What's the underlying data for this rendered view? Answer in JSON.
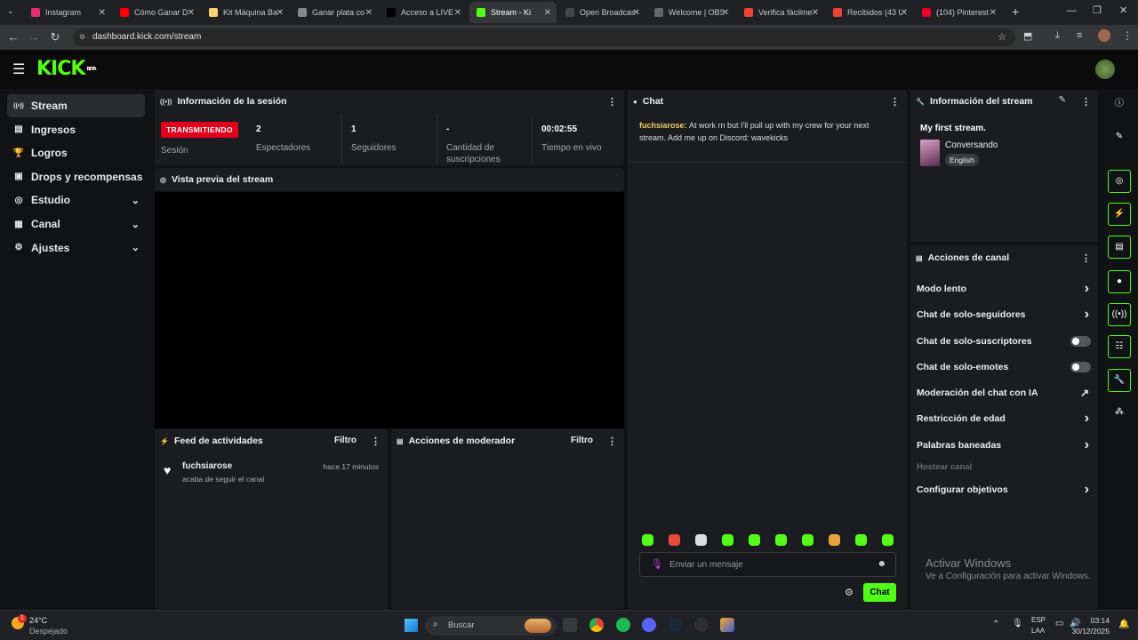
{
  "browser": {
    "tabs": [
      {
        "title": "Instagram",
        "color": "#e1306c"
      },
      {
        "title": "Cómo Ganar D",
        "color": "#ff0000"
      },
      {
        "title": "Kit Máquina Ba",
        "color": "#f5d76e"
      },
      {
        "title": "Ganar plata co",
        "color": "#888888"
      },
      {
        "title": "Acceso a LIVE",
        "color": "#000000"
      },
      {
        "title": "Stream - Ki",
        "color": "#53fc18"
      },
      {
        "title": "Open Broadcas",
        "color": "#444444"
      },
      {
        "title": "Welcome | OBS",
        "color": "#666666"
      },
      {
        "title": "Verifica fácilme",
        "color": "#ea4335"
      },
      {
        "title": "Recibidos (43 U",
        "color": "#ea4335"
      },
      {
        "title": "(104) Pinterest",
        "color": "#e60023"
      }
    ],
    "url": "dashboard.kick.com/stream"
  },
  "brand": {
    "logo": "KICK",
    "beta": "BETA",
    "accent": "#53fc18"
  },
  "sidebar": {
    "items": [
      {
        "label": "Stream",
        "icon": "broadcast-icon"
      },
      {
        "label": "Ingresos",
        "icon": "money-icon"
      },
      {
        "label": "Logros",
        "icon": "trophy-icon"
      },
      {
        "label": "Drops y recompensas",
        "icon": "gift-icon"
      },
      {
        "label": "Estudio",
        "icon": "studio-icon"
      },
      {
        "label": "Canal",
        "icon": "channel-icon"
      },
      {
        "label": "Ajustes",
        "icon": "gear-icon"
      }
    ]
  },
  "session": {
    "title": "Información de la sesión",
    "status": "TRANSMITIENDO",
    "status_label": "Sesión",
    "viewers": "2",
    "viewers_label": "Espectadores",
    "followers": "1",
    "followers_label": "Seguidores",
    "subs": "-",
    "subs_label": "Cantidad de suscripciones",
    "live_time": "00:02:55",
    "live_time_label": "Tiempo en vivo"
  },
  "preview": {
    "title": "Vista previa del stream"
  },
  "feed": {
    "title": "Feed de actividades",
    "filter": "Filtro",
    "items": [
      {
        "user": "fuchsiarose",
        "text": "acaba de seguir el canal",
        "time": "hace 17 minutos"
      }
    ]
  },
  "mod": {
    "title": "Acciones de moderador",
    "filter": "Filtro"
  },
  "chat": {
    "title": "Chat",
    "messages": [
      {
        "user": "fuchsiarose",
        "text": "At work rn but I'll pull up with my crew for your next stream. Add me up on Discord:  wavekicks"
      }
    ],
    "placeholder": "Enviar un mensaje",
    "send": "Chat"
  },
  "stream_info": {
    "title": "Información del stream",
    "stream_title": "My first stream.",
    "category": "Conversando",
    "language": "English"
  },
  "channel_actions": {
    "title": "Acciones de canal",
    "items": [
      {
        "label": "Modo lento",
        "type": "arrow"
      },
      {
        "label": "Chat de solo-seguidores",
        "type": "arrow"
      },
      {
        "label": "Chat de solo-suscriptores",
        "type": "toggle"
      },
      {
        "label": "Chat de solo-emotes",
        "type": "toggle"
      },
      {
        "label": "Moderación del chat con IA",
        "type": "external"
      },
      {
        "label": "Restricción de edad",
        "type": "arrow"
      },
      {
        "label": "Palabras baneadas",
        "type": "arrow"
      },
      {
        "label": "Hostear canal",
        "type": "disabled"
      },
      {
        "label": "Configurar objetivos",
        "type": "arrow"
      }
    ]
  },
  "watermark": {
    "line1": "Activar Windows",
    "line2": "Ve a Configuración para activar Windows."
  },
  "taskbar": {
    "weather_temp": "24°C",
    "weather_desc": "Despejado",
    "notif_count": "1",
    "search": "Buscar",
    "lang": "ESP",
    "lang2": "LAA",
    "time": "03:14",
    "date": "30/12/2025"
  }
}
